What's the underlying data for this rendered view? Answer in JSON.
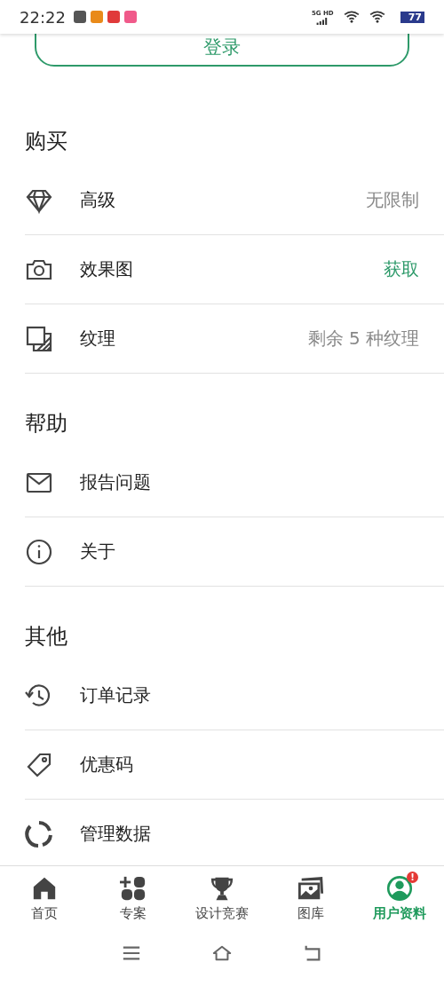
{
  "status_bar": {
    "time": "22:22",
    "network": "5G HD",
    "battery": "77"
  },
  "login_button": {
    "label": "登录"
  },
  "sections": [
    {
      "title": "购买",
      "items": [
        {
          "label": "高级",
          "value": "无限制",
          "kind": "info"
        },
        {
          "label": "效果图",
          "value": "获取",
          "kind": "action"
        },
        {
          "label": "纹理",
          "value": "剩余 5 种纹理",
          "kind": "info"
        }
      ]
    },
    {
      "title": "帮助",
      "items": [
        {
          "label": "报告问题"
        },
        {
          "label": "关于"
        }
      ]
    },
    {
      "title": "其他",
      "items": [
        {
          "label": "订单记录"
        },
        {
          "label": "优惠码"
        },
        {
          "label": "管理数据"
        }
      ]
    }
  ],
  "bottom_nav": [
    {
      "label": "首页",
      "selected": false
    },
    {
      "label": "专案",
      "selected": false
    },
    {
      "label": "设计竞赛",
      "selected": false
    },
    {
      "label": "图库",
      "selected": false
    },
    {
      "label": "用户资料",
      "selected": true,
      "badge": "!"
    }
  ]
}
